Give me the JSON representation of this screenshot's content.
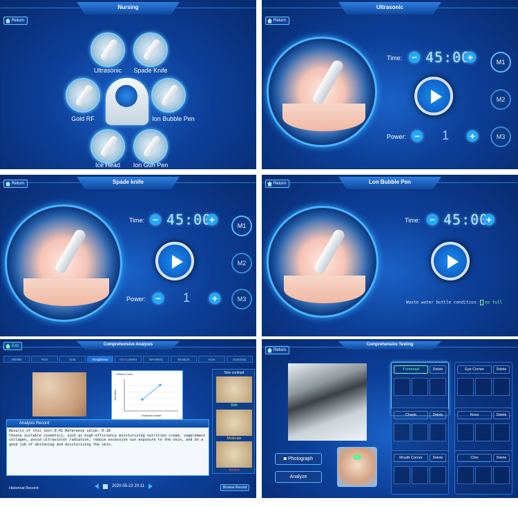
{
  "common": {
    "return_label": "Return"
  },
  "nursing": {
    "title": "Nursing",
    "items": [
      "Ultrasonic",
      "Spade Knife",
      "Gold RF",
      "Ion Bubble Pen",
      "Ice Head",
      "Ion Gun Pen"
    ]
  },
  "ultrasonic": {
    "title": "Ultrasonic",
    "time_label": "Time:",
    "time_value": "45:00",
    "power_label": "Power:",
    "power_value": "1",
    "modes": [
      "M1",
      "M2",
      "M3"
    ]
  },
  "spade": {
    "title": "Spade knife",
    "time_label": "Time:",
    "time_value": "45:00",
    "power_label": "Power:",
    "power_value": "1",
    "modes": [
      "M1",
      "M2",
      "M3"
    ]
  },
  "bubble": {
    "title": "Lon Bubble Pen",
    "time_label": "Time:",
    "time_value": "45:00",
    "waste_label": "Waste water bottle condition:",
    "waste_status": "no full"
  },
  "analysis": {
    "exit_label": "Exit",
    "title": "Comprehensive Analysis",
    "tabs": [
      "Wrinkle",
      "Pore",
      "Spot",
      "Roughness",
      "UCI Content",
      "Sensitivity",
      "Moisture",
      "Acne",
      "Summary"
    ],
    "active_tab": "Roughness",
    "chart_title": "History Curve",
    "chart_ylabel": "Test Value",
    "chart_xlabel": "Treatment Number",
    "skin_contrast_title": "Skin contrast",
    "skin_levels": [
      "Mild",
      "Moderate",
      "Severe"
    ],
    "record_title": "Analysis Record",
    "record_line1": "Results of this test:0.41   Reference value: 0.18",
    "record_line2": "Choose suitable cosmetics, such as high-efficiency moisturizing nutrition cream, supplement collagen, avoid ultraviolet radiation, reduce excessive sun exposure to the skin, and do a good job of whitening and moisturizing the skin.",
    "historical_label": "Historical Record:",
    "date": "2020-05-22 20:11",
    "browse_label": "Browse Record"
  },
  "testing": {
    "title": "Comprehensive Testing",
    "photograph_label": "Photograph",
    "analyze_label": "Analyze",
    "delete_label": "Delete",
    "zones": [
      "Forehead",
      "Eye Corner",
      "Cheek",
      "Nose",
      "Mouth Corner",
      "Chin"
    ]
  },
  "colors": {
    "accent": "#23a8ff",
    "status_ok": "#7dff99",
    "panel_bg": "#0d3f98"
  },
  "chart_data": {
    "type": "line",
    "title": "History Curve",
    "xlabel": "Treatment Number",
    "ylabel": "Test Value",
    "x": [
      1,
      2
    ],
    "values": [
      0.18,
      0.41
    ]
  }
}
